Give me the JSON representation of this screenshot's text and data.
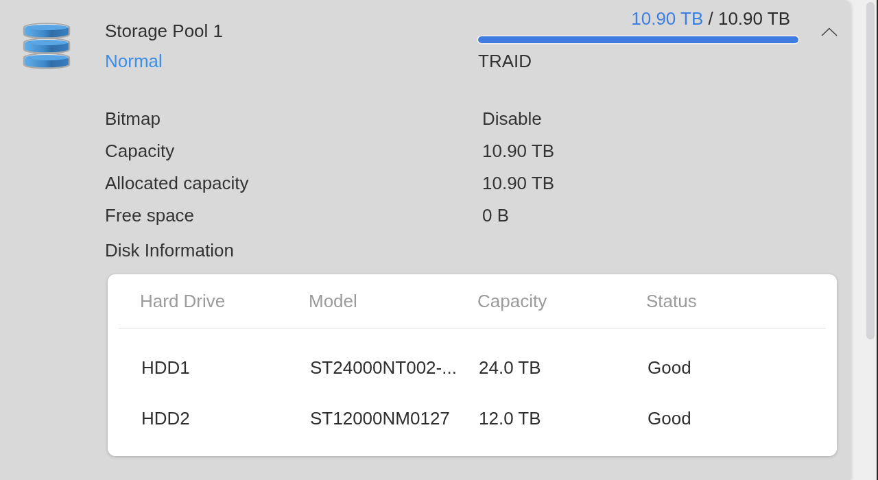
{
  "pool": {
    "name": "Storage Pool 1",
    "status": "Normal",
    "used": "10.90 TB",
    "separator": "/",
    "total": "10.90 TB",
    "level": 1,
    "raid_type": "TRAID",
    "expanded": true
  },
  "details": [
    {
      "label": "Bitmap",
      "value": "Disable"
    },
    {
      "label": "Capacity",
      "value": "10.90 TB"
    },
    {
      "label": "Allocated capacity",
      "value": "10.90 TB"
    },
    {
      "label": "Free space",
      "value": "0 B"
    }
  ],
  "disk_information": {
    "title": "Disk Information",
    "table": {
      "columns": [
        "Hard Drive",
        "Model",
        "Capacity",
        "Status"
      ],
      "rows": [
        [
          "HDD1",
          "ST24000NT002-...",
          "24.0 TB",
          "Good"
        ],
        [
          "HDD2",
          "ST12000NM0127",
          "12.0 TB",
          "Good"
        ]
      ]
    }
  }
}
